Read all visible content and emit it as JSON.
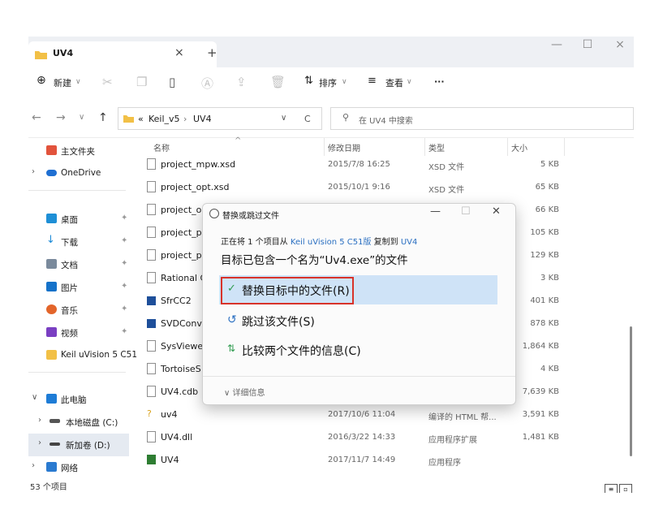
{
  "window": {
    "tab_title": "UV4",
    "tab_close": "×",
    "new_tab": "+",
    "minimize": "—",
    "maximize": "☐",
    "close": "×"
  },
  "toolbar": {
    "new_label": "新建",
    "sort_label": "排序",
    "view_label": "查看",
    "more_label": "···"
  },
  "address": {
    "back": "←",
    "forward": "→",
    "recent": "∨",
    "up": "↑",
    "prefix": "«",
    "crumbs": [
      "Keil_v5",
      "UV4"
    ],
    "separator": "›",
    "dropdown": "∨",
    "refresh": "C",
    "search_placeholder": "在 UV4 中搜索"
  },
  "sidebar": {
    "items": [
      {
        "label": "主文件夹",
        "icon": "home-icon",
        "color": "#e2533c"
      },
      {
        "label": "OneDrive",
        "icon": "cloud-icon",
        "color": "#1f6fd2"
      },
      {
        "label": "桌面",
        "icon": "desktop-icon",
        "color": "#1e8fd6"
      },
      {
        "label": "下载",
        "icon": "download-icon",
        "color": "#1b8ad7"
      },
      {
        "label": "文档",
        "icon": "document-icon",
        "color": "#7a8a9c"
      },
      {
        "label": "图片",
        "icon": "picture-icon",
        "color": "#1572c9"
      },
      {
        "label": "音乐",
        "icon": "music-icon",
        "color": "#e3652a"
      },
      {
        "label": "视频",
        "icon": "video-icon",
        "color": "#7a3fc2"
      },
      {
        "label": "Keil uVision 5 C51",
        "icon": "folder-icon",
        "color": "#f2c046"
      },
      {
        "label": "此电脑",
        "icon": "computer-icon",
        "color": "#1e7cd6"
      },
      {
        "label": "本地磁盘 (C:)",
        "icon": "drive-icon",
        "color": "#555555"
      },
      {
        "label": "新加卷 (D:)",
        "icon": "drive-icon",
        "color": "#444444"
      },
      {
        "label": "网络",
        "icon": "network-icon",
        "color": "#2a7ad0"
      }
    ],
    "status": "53 个项目"
  },
  "columns": {
    "name": "名称",
    "date": "修改日期",
    "type": "类型",
    "size": "大小"
  },
  "files": [
    {
      "name": "project_mpw.xsd",
      "date": "2015/7/8 16:25",
      "type": "XSD 文件",
      "size": "5 KB"
    },
    {
      "name": "project_opt.xsd",
      "date": "2015/10/1 9:16",
      "type": "XSD 文件",
      "size": "65 KB"
    },
    {
      "name": "project_op",
      "date": "",
      "type": "",
      "size": "66 KB"
    },
    {
      "name": "project_pr",
      "date": "",
      "type": "",
      "size": "105 KB"
    },
    {
      "name": "project_pr",
      "date": "",
      "type": "",
      "size": "129 KB"
    },
    {
      "name": "Rational C",
      "date": "",
      "type": "",
      "size": "3 KB"
    },
    {
      "name": "SfrCC2",
      "date": "",
      "type": "",
      "size": "401 KB"
    },
    {
      "name": "SVDConv",
      "date": "",
      "type": "",
      "size": "878 KB"
    },
    {
      "name": "SysViewer",
      "date": "",
      "type": "",
      "size": "1,864 KB"
    },
    {
      "name": "TortoiseS",
      "date": "",
      "type": "",
      "size": "4 KB"
    },
    {
      "name": "UV4.cdb",
      "date": "",
      "type": "",
      "size": "7,639 KB"
    },
    {
      "name": "uv4",
      "date": "2017/10/6 11:04",
      "type": "编译的 HTML 帮...",
      "size": "3,591 KB"
    },
    {
      "name": "UV4.dll",
      "date": "2016/3/22 14:33",
      "type": "应用程序扩展",
      "size": "1,481 KB"
    },
    {
      "name": "UV4",
      "date": "2017/11/7 14:49",
      "type": "应用程序",
      "size": ""
    }
  ],
  "dialog": {
    "title": "替换或跳过文件",
    "minimize": "—",
    "maximize": "☐",
    "close": "✕",
    "copy_pre": "正在将 1 个项目从",
    "copy_source": "Keil uVision 5 C51版",
    "copy_mid": "复制到",
    "copy_dest": "UV4",
    "conflict": "目标已包含一个名为“Uv4.exe”的文件",
    "replace": "替换目标中的文件(R)",
    "skip": "跳过该文件(S)",
    "compare": "比较两个文件的信息(C)",
    "more_info": "详细信息"
  },
  "colors": {
    "accent": "#2a6fc1",
    "highlight": "#cfe3f7",
    "red_box": "#d8332a"
  }
}
